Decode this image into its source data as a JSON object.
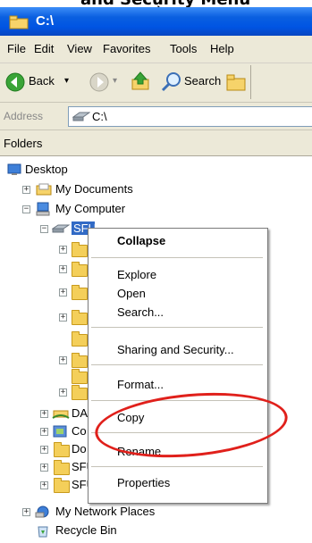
{
  "caption": "and Security Menu",
  "window": {
    "title": "C:\\"
  },
  "menu": [
    "File",
    "Edit",
    "View",
    "Favorites",
    "Tools",
    "Help"
  ],
  "toolbar": {
    "back": "Back",
    "search": "Search"
  },
  "address": {
    "label": "Address",
    "value": "C:\\"
  },
  "folders_header": "Folders",
  "tree": {
    "desktop": "Desktop",
    "my_documents": "My Documents",
    "my_computer": "My Computer",
    "drive": "SFU (C:)",
    "da": "DA",
    "co": "Co",
    "do": "Do",
    "sf1": "SFU",
    "sf2": "SFU",
    "my_network_places": "My Network Places",
    "recycle_bin": "Recycle Bin"
  },
  "context_menu": {
    "collapse": "Collapse",
    "explore": "Explore",
    "open": "Open",
    "search": "Search...",
    "sharing": "Sharing and Security...",
    "format": "Format...",
    "copy": "Copy",
    "rename": "Rename",
    "properties": "Properties"
  },
  "colors": {
    "titlebar": "#0054e3",
    "highlight_ring": "#e0201b",
    "chrome": "#ece9d8"
  },
  "icons": [
    "folder-icon",
    "desktop-icon",
    "my-computer-icon",
    "drive-icon",
    "network-icon",
    "recycle-bin-icon",
    "back-icon",
    "forward-icon",
    "up-icon",
    "search-icon",
    "cursor-icon"
  ]
}
